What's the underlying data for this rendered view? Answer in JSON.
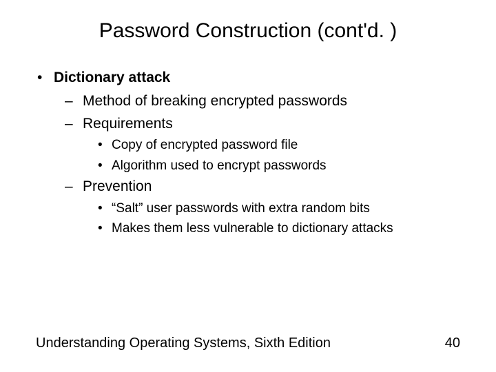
{
  "title": "Password Construction (cont'd. )",
  "bullets": {
    "lvl1": {
      "label": "Dictionary attack"
    },
    "method": "Method of breaking encrypted passwords",
    "requirements": {
      "label": "Requirements",
      "sub1": "Copy of encrypted password file",
      "sub2": "Algorithm used to encrypt passwords"
    },
    "prevention": {
      "label": "Prevention",
      "sub1": "“Salt” user passwords with extra random bits",
      "sub2": "Makes them less vulnerable to dictionary attacks"
    }
  },
  "footer": {
    "book": "Understanding Operating Systems, Sixth Edition",
    "page": "40"
  }
}
